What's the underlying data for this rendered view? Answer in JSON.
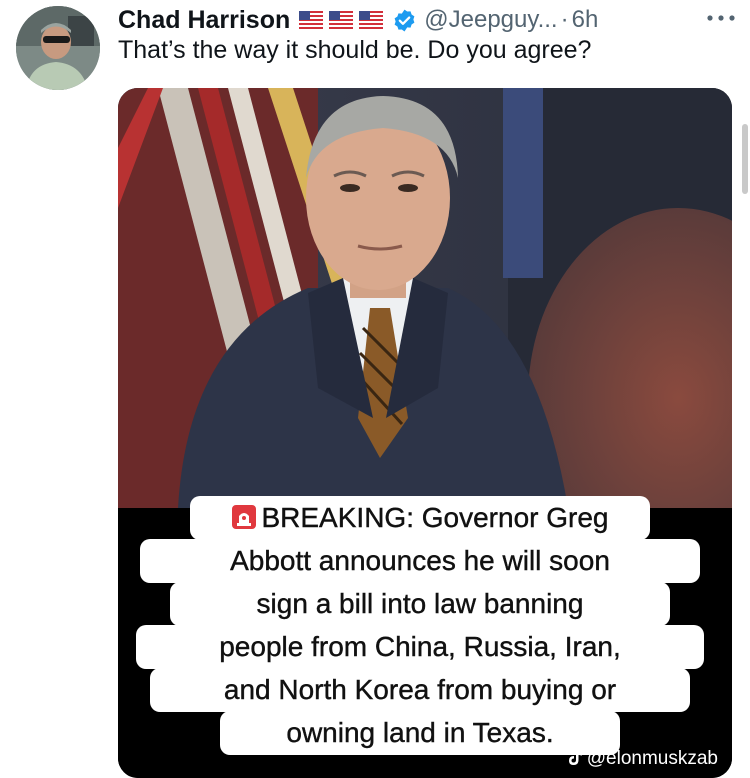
{
  "author": {
    "display_name": "Chad Harrison",
    "handle": "@Jeepguy...",
    "separator": "·",
    "timestamp": "6h",
    "flags": [
      "us-flag-icon",
      "us-flag-icon",
      "us-flag-icon"
    ],
    "verified_icon": "verified-badge-icon"
  },
  "tweet": {
    "text": "That’s the way it should be. Do you agree?"
  },
  "media": {
    "caption_lines": [
      "BREAKING: Governor Greg",
      "Abbott announces he will soon",
      "sign a bill into law banning",
      "people from China, Russia, Iran,",
      "and North Korea from buying or",
      "owning land in Texas."
    ],
    "caption_icon": "siren-emoji-icon",
    "watermark": "@elonmuskzab",
    "watermark_icon": "tiktok-icon"
  },
  "colors": {
    "text_primary": "#0f1419",
    "text_secondary": "#536471",
    "verified_blue": "#1d9bf0"
  }
}
